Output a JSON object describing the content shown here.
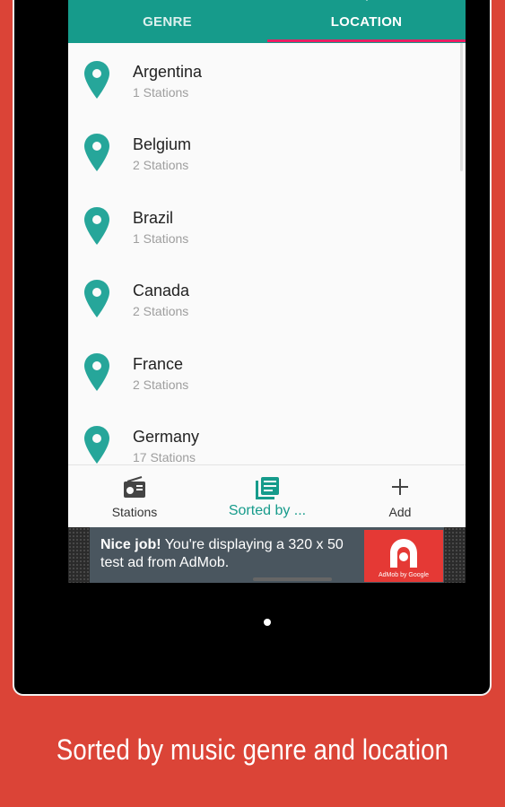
{
  "tabs": [
    {
      "label": "GENRE",
      "icon": "genre-icon"
    },
    {
      "label": "LOCATION",
      "icon": "location-icon"
    }
  ],
  "locations": [
    {
      "name": "Argentina",
      "count": "1 Stations"
    },
    {
      "name": "Belgium",
      "count": "2 Stations"
    },
    {
      "name": "Brazil",
      "count": "1 Stations"
    },
    {
      "name": "Canada",
      "count": "2 Stations"
    },
    {
      "name": "France",
      "count": "2 Stations"
    },
    {
      "name": "Germany",
      "count": "17 Stations"
    }
  ],
  "bottom_nav": [
    {
      "label": "Stations",
      "icon": "radio-icon"
    },
    {
      "label": "Sorted by ...",
      "icon": "list-icon"
    },
    {
      "label": "Add",
      "icon": "plus-icon"
    }
  ],
  "ad": {
    "bold": "Nice job!",
    "text": " You're displaying a 320 x 50 test ad from AdMob.",
    "logo_text": "AdMob by Google"
  },
  "caption": "Sorted by music genre and location",
  "colors": {
    "accent": "#169b8b",
    "indicator": "#e91e63",
    "background": "#DB4437"
  }
}
